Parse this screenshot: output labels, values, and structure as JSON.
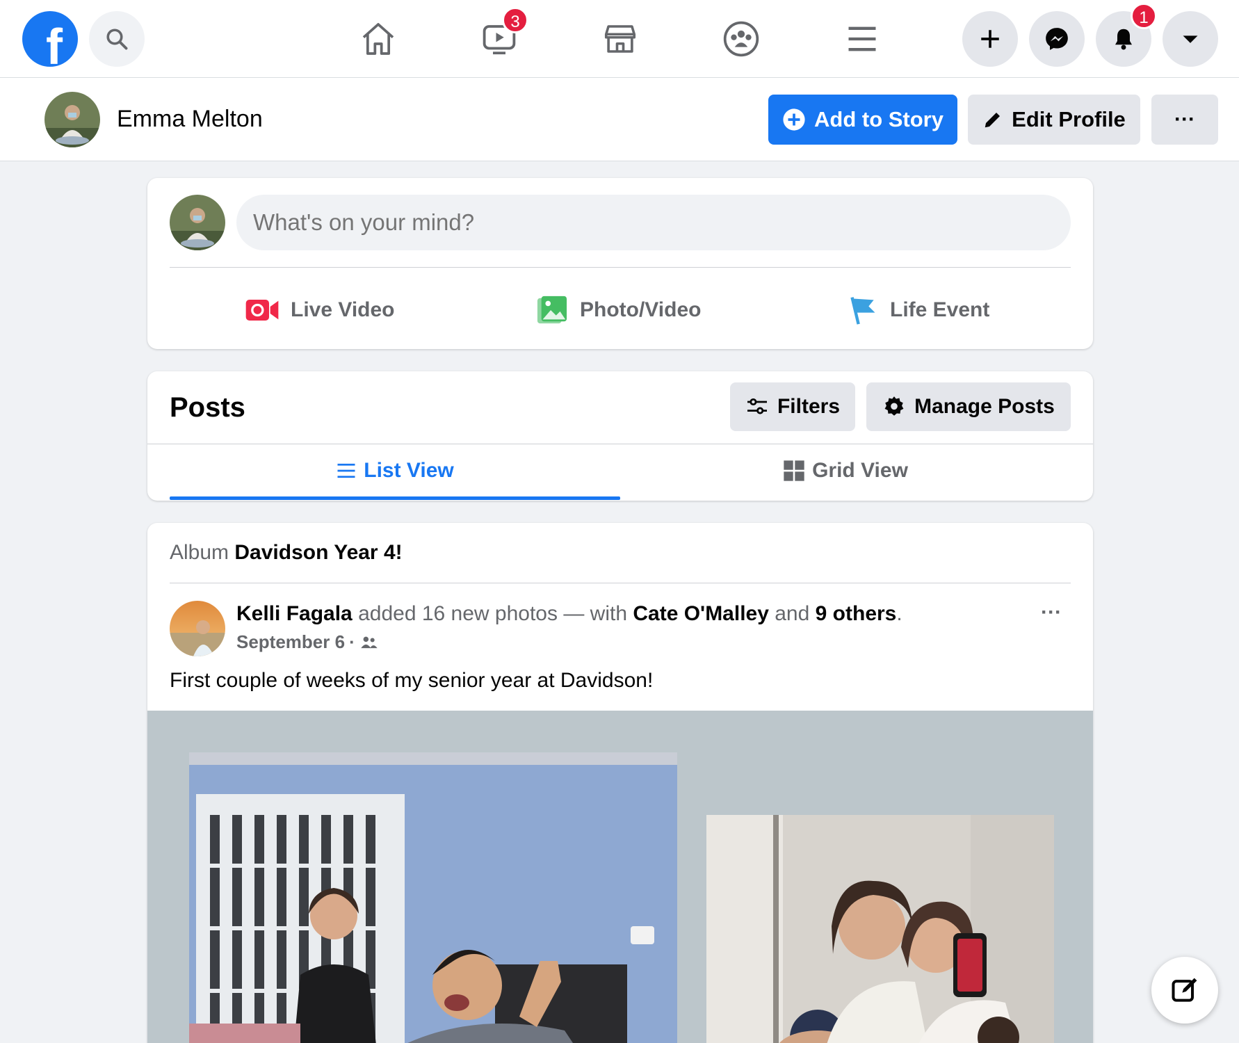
{
  "nav": {
    "logo_letter": "f",
    "watch_badge": "3",
    "notifications_badge": "1"
  },
  "profile": {
    "name": "Emma Melton",
    "add_story": "Add to Story",
    "edit_profile": "Edit Profile",
    "more": "···"
  },
  "composer": {
    "placeholder": "What's on your mind?",
    "actions": [
      {
        "label": "Live Video",
        "icon": "live-video-icon",
        "color": "#f02849"
      },
      {
        "label": "Photo/Video",
        "icon": "photo-icon",
        "color": "#45bd62"
      },
      {
        "label": "Life Event",
        "icon": "flag-icon",
        "color": "#3ba1e0"
      }
    ]
  },
  "posts": {
    "title": "Posts",
    "filters": "Filters",
    "manage": "Manage Posts",
    "tabs": [
      {
        "label": "List View",
        "active": true
      },
      {
        "label": "Grid View",
        "active": false
      }
    ]
  },
  "post": {
    "album_prefix": "Album",
    "album_name": "Davidson Year 4!",
    "author": "Kelli Fagala",
    "action_text": "added 16 new photos — with",
    "tagged": "Cate O'Malley",
    "and": "and",
    "others": "9 others",
    "period": ".",
    "date": "September 6",
    "dot": "·",
    "text": "First couple of weeks of my senior year at Davidson!",
    "more": "···"
  },
  "colors": {
    "brand": "#1877f2",
    "badge": "#e41e3f"
  }
}
